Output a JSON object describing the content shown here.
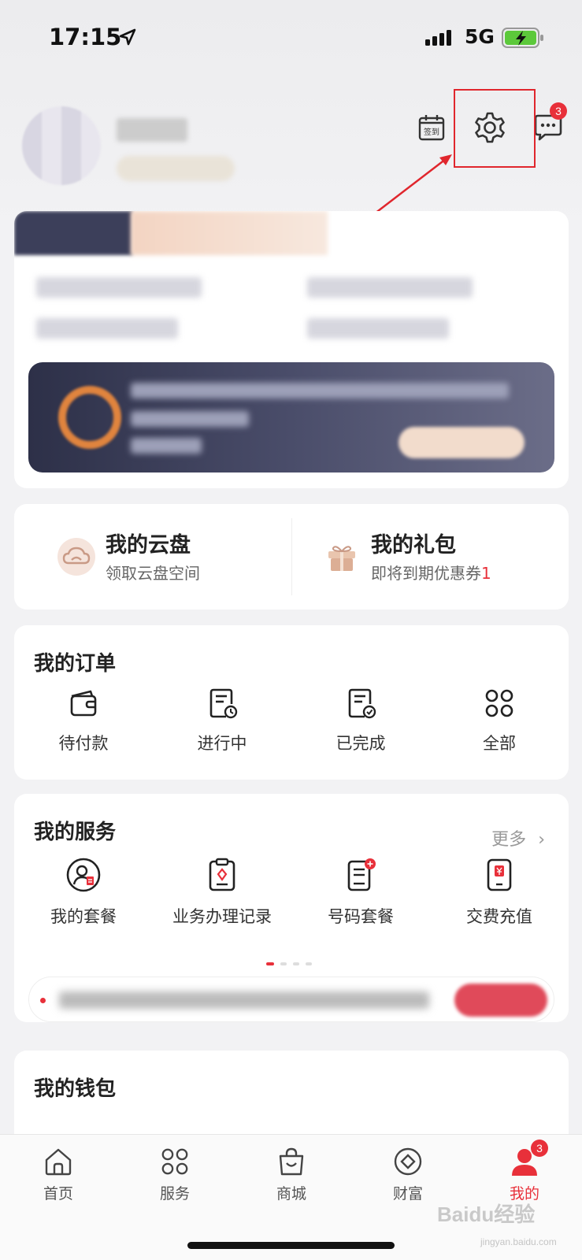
{
  "status_bar": {
    "time": "17:15",
    "network": "5G"
  },
  "header": {
    "signin_label": "签到",
    "message_badge": "3"
  },
  "quick_links": [
    {
      "title": "我的云盘",
      "subtitle": "领取云盘空间",
      "count": ""
    },
    {
      "title": "我的礼包",
      "subtitle": "即将到期优惠券",
      "count": "1"
    }
  ],
  "orders": {
    "title": "我的订单",
    "items": [
      {
        "label": "待付款",
        "icon": "wallet-icon"
      },
      {
        "label": "进行中",
        "icon": "doc-clock-icon"
      },
      {
        "label": "已完成",
        "icon": "doc-check-icon"
      },
      {
        "label": "全部",
        "icon": "grid-icon"
      }
    ]
  },
  "services": {
    "title": "我的服务",
    "more_label": "更多",
    "items": [
      {
        "label": "我的套餐",
        "icon": "user-package-icon"
      },
      {
        "label": "业务办理记录",
        "icon": "clipboard-icon"
      },
      {
        "label": "号码套餐",
        "icon": "sim-package-icon"
      },
      {
        "label": "交费充值",
        "icon": "phone-recharge-icon"
      }
    ],
    "page_count": 4,
    "active_page": 1
  },
  "wallet": {
    "title": "我的钱包"
  },
  "tabbar": {
    "items": [
      {
        "label": "首页",
        "icon": "home-icon",
        "active": false
      },
      {
        "label": "服务",
        "icon": "grid-icon",
        "active": false
      },
      {
        "label": "商城",
        "icon": "shopping-bag-icon",
        "active": false
      },
      {
        "label": "财富",
        "icon": "diamond-coin-icon",
        "active": false
      },
      {
        "label": "我的",
        "icon": "user-icon",
        "active": true,
        "badge": "3"
      }
    ]
  },
  "watermark": {
    "brand": "Baidu经验",
    "domain": "jingyan.baidu.com"
  },
  "colors": {
    "accent": "#e8303a",
    "annotation": "#e0262d"
  }
}
